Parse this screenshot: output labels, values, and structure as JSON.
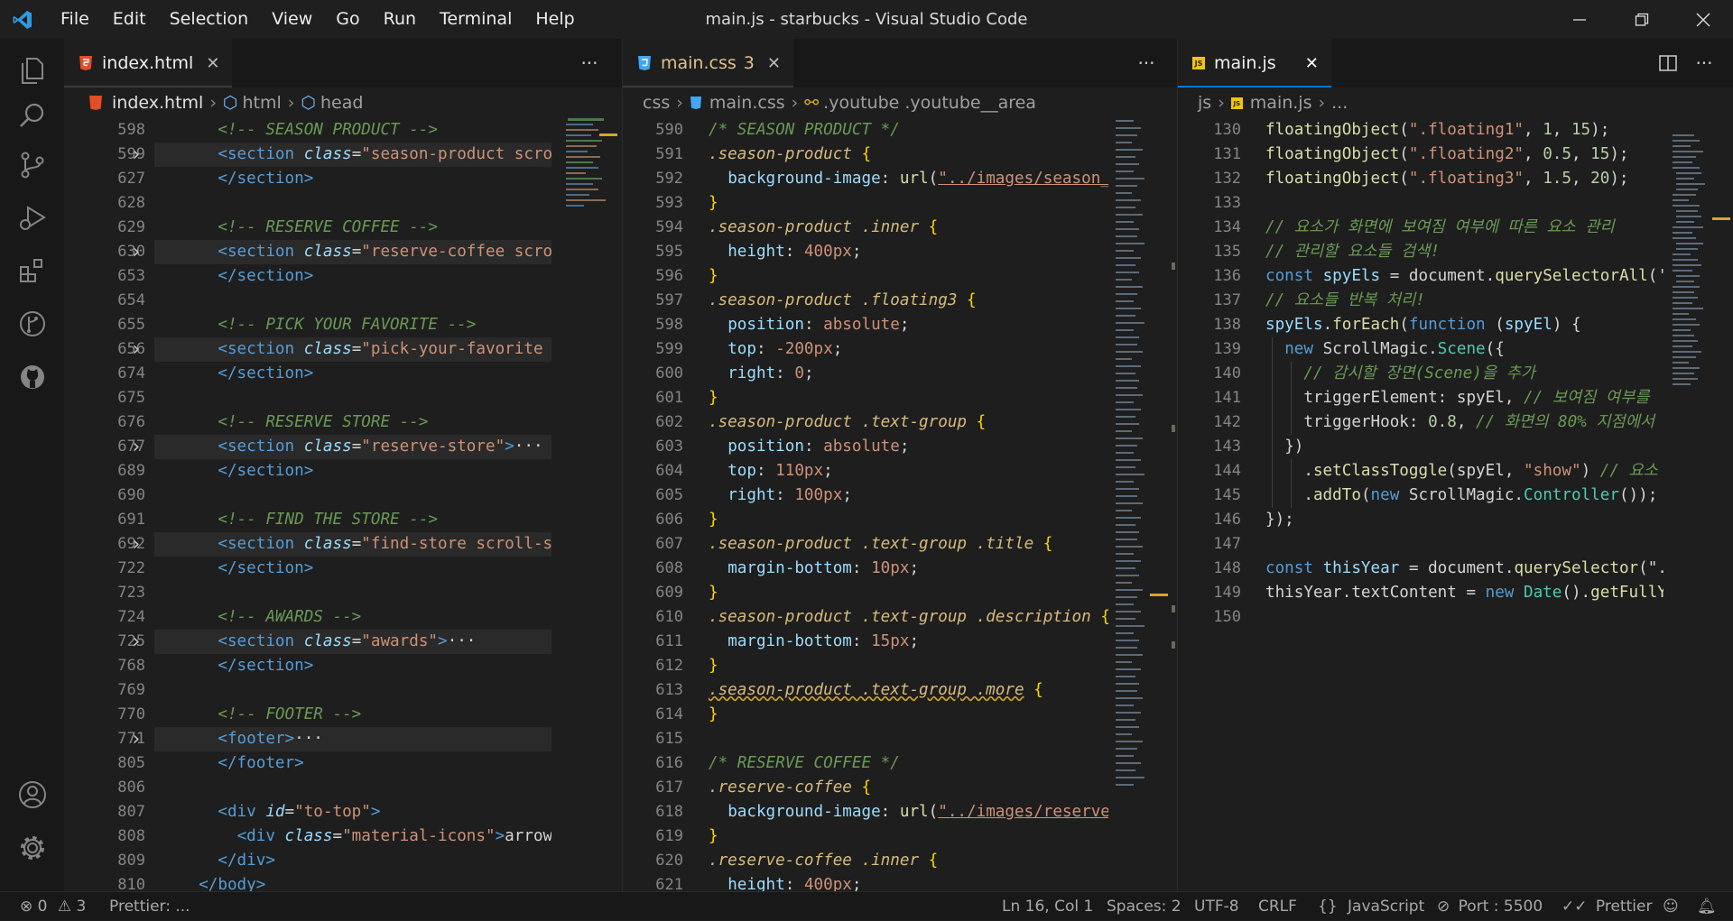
{
  "menu": [
    "File",
    "Edit",
    "Selection",
    "View",
    "Go",
    "Run",
    "Terminal",
    "Help"
  ],
  "window_title": "main.js - starbucks - Visual Studio Code",
  "panes": [
    {
      "tab": {
        "label": "index.html",
        "badge": ""
      },
      "crumbs": [
        "index.html",
        "html",
        "head"
      ],
      "lines": [
        {
          "n": "598",
          "fold": false,
          "html": "    <span class='c-com'>&lt;!-- SEASON PRODUCT --&gt;</span>"
        },
        {
          "n": "599",
          "fold": true,
          "hl": true,
          "html": "    <span class='c-tag'>&lt;section</span> <span class='c-attr'>class</span><span class='c-txt'>=</span><span class='c-str'>\"season-product scroll-</span>"
        },
        {
          "n": "627",
          "fold": false,
          "html": "    <span class='c-tag'>&lt;/section&gt;</span>"
        },
        {
          "n": "628",
          "fold": false,
          "html": ""
        },
        {
          "n": "629",
          "fold": false,
          "html": "    <span class='c-com'>&lt;!-- RESERVE COFFEE --&gt;</span>"
        },
        {
          "n": "630",
          "fold": true,
          "hl": true,
          "html": "    <span class='c-tag'>&lt;section</span> <span class='c-attr'>class</span><span class='c-txt'>=</span><span class='c-str'>\"reserve-coffee scroll-</span>"
        },
        {
          "n": "653",
          "fold": false,
          "html": "    <span class='c-tag'>&lt;/section&gt;</span>"
        },
        {
          "n": "654",
          "fold": false,
          "html": ""
        },
        {
          "n": "655",
          "fold": false,
          "html": "    <span class='c-com'>&lt;!-- PICK YOUR FAVORITE --&gt;</span>"
        },
        {
          "n": "656",
          "fold": true,
          "hl": true,
          "html": "    <span class='c-tag'>&lt;section</span> <span class='c-attr'>class</span><span class='c-txt'>=</span><span class='c-str'>\"pick-your-favorite scr</span>"
        },
        {
          "n": "674",
          "fold": false,
          "html": "    <span class='c-tag'>&lt;/section&gt;</span>"
        },
        {
          "n": "675",
          "fold": false,
          "html": ""
        },
        {
          "n": "676",
          "fold": false,
          "html": "    <span class='c-com'>&lt;!-- RESERVE STORE --&gt;</span>"
        },
        {
          "n": "677",
          "fold": true,
          "hl": true,
          "html": "    <span class='c-tag'>&lt;section</span> <span class='c-attr'>class</span><span class='c-txt'>=</span><span class='c-str'>\"reserve-store\"</span><span class='c-tag'>&gt;</span><span class='c-txt'>···</span>"
        },
        {
          "n": "689",
          "fold": false,
          "html": "    <span class='c-tag'>&lt;/section&gt;</span>"
        },
        {
          "n": "690",
          "fold": false,
          "html": ""
        },
        {
          "n": "691",
          "fold": false,
          "html": "    <span class='c-com'>&lt;!-- FIND THE STORE --&gt;</span>"
        },
        {
          "n": "692",
          "fold": true,
          "hl": true,
          "html": "    <span class='c-tag'>&lt;section</span> <span class='c-attr'>class</span><span class='c-txt'>=</span><span class='c-str'>\"find-store scroll-spy'</span>"
        },
        {
          "n": "722",
          "fold": false,
          "html": "    <span class='c-tag'>&lt;/section&gt;</span>"
        },
        {
          "n": "723",
          "fold": false,
          "html": ""
        },
        {
          "n": "724",
          "fold": false,
          "html": "    <span class='c-com'>&lt;!-- AWARDS --&gt;</span>"
        },
        {
          "n": "725",
          "fold": true,
          "hl": true,
          "html": "    <span class='c-tag'>&lt;section</span> <span class='c-attr'>class</span><span class='c-txt'>=</span><span class='c-str'>\"awards\"</span><span class='c-tag'>&gt;</span><span class='c-txt'>···</span>"
        },
        {
          "n": "768",
          "fold": false,
          "html": "    <span class='c-tag'>&lt;/section&gt;</span>"
        },
        {
          "n": "769",
          "fold": false,
          "html": ""
        },
        {
          "n": "770",
          "fold": false,
          "html": "    <span class='c-com'>&lt;!-- FOOTER --&gt;</span>"
        },
        {
          "n": "771",
          "fold": true,
          "hl": true,
          "html": "    <span class='c-tag'>&lt;footer&gt;</span><span class='c-txt'>···</span>"
        },
        {
          "n": "805",
          "fold": false,
          "html": "    <span class='c-tag'>&lt;/footer&gt;</span>"
        },
        {
          "n": "806",
          "fold": false,
          "html": ""
        },
        {
          "n": "807",
          "fold": false,
          "html": "    <span class='c-tag'>&lt;div</span> <span class='c-attr'>id</span><span class='c-txt'>=</span><span class='c-str'>\"to-top\"</span><span class='c-tag'>&gt;</span>"
        },
        {
          "n": "808",
          "fold": false,
          "html": "      <span class='c-tag'>&lt;div</span> <span class='c-attr'>class</span><span class='c-txt'>=</span><span class='c-str'>\"material-icons\"</span><span class='c-tag'>&gt;</span><span class='c-txt'>arrow_up</span>"
        },
        {
          "n": "809",
          "fold": false,
          "html": "    <span class='c-tag'>&lt;/div&gt;</span>"
        },
        {
          "n": "810",
          "fold": false,
          "html": "  <span class='c-tag'>&lt;/body&gt;</span>"
        }
      ]
    },
    {
      "tab": {
        "label": "main.css",
        "badge": "3"
      },
      "crumbs": [
        "css",
        "main.css",
        ".youtube .youtube__area"
      ],
      "lines": [
        {
          "n": "590",
          "html": "<span class='c-com'>/* SEASON PRODUCT */</span>"
        },
        {
          "n": "591",
          "html": "<span class='c-sel'>.season-product</span> <span class='c-punc'>{</span>"
        },
        {
          "n": "592",
          "html": "  <span class='c-prop'>background-image</span><span class='c-txt'>: </span><span class='c-fn'>url</span><span class='c-txt'>(</span><span class='c-str' style='text-decoration:underline'>\"../images/season_</span>"
        },
        {
          "n": "593",
          "html": "<span class='c-punc'>}</span>"
        },
        {
          "n": "594",
          "html": "<span class='c-sel'>.season-product</span> <span class='c-sel'>.inner</span> <span class='c-punc'>{</span>"
        },
        {
          "n": "595",
          "html": "  <span class='c-prop'>height</span><span class='c-txt'>: </span><span class='c-str'>400px</span><span class='c-txt'>;</span>"
        },
        {
          "n": "596",
          "html": "<span class='c-punc'>}</span>"
        },
        {
          "n": "597",
          "html": "<span class='c-sel'>.season-product</span> <span class='c-sel'>.floating3</span> <span class='c-punc'>{</span>"
        },
        {
          "n": "598",
          "html": "  <span class='c-prop'>position</span><span class='c-txt'>: </span><span class='c-str'>absolute</span><span class='c-txt'>;</span>"
        },
        {
          "n": "599",
          "html": "  <span class='c-prop'>top</span><span class='c-txt'>: </span><span class='c-str'>-200px</span><span class='c-txt'>;</span>"
        },
        {
          "n": "600",
          "html": "  <span class='c-prop'>right</span><span class='c-txt'>: </span><span class='c-str'>0</span><span class='c-txt'>;</span>"
        },
        {
          "n": "601",
          "html": "<span class='c-punc'>}</span>"
        },
        {
          "n": "602",
          "html": "<span class='c-sel'>.season-product</span> <span class='c-sel'>.text-group</span> <span class='c-punc'>{</span>"
        },
        {
          "n": "603",
          "html": "  <span class='c-prop'>position</span><span class='c-txt'>: </span><span class='c-str'>absolute</span><span class='c-txt'>;</span>"
        },
        {
          "n": "604",
          "html": "  <span class='c-prop'>top</span><span class='c-txt'>: </span><span class='c-str'>110px</span><span class='c-txt'>;</span>"
        },
        {
          "n": "605",
          "html": "  <span class='c-prop'>right</span><span class='c-txt'>: </span><span class='c-str'>100px</span><span class='c-txt'>;</span>"
        },
        {
          "n": "606",
          "html": "<span class='c-punc'>}</span>"
        },
        {
          "n": "607",
          "html": "<span class='c-sel'>.season-product</span> <span class='c-sel'>.text-group</span> <span class='c-sel'>.title</span> <span class='c-punc'>{</span>"
        },
        {
          "n": "608",
          "html": "  <span class='c-prop'>margin-bottom</span><span class='c-txt'>: </span><span class='c-str'>10px</span><span class='c-txt'>;</span>"
        },
        {
          "n": "609",
          "html": "<span class='c-punc'>}</span>"
        },
        {
          "n": "610",
          "html": "<span class='c-sel'>.season-product</span> <span class='c-sel'>.text-group</span> <span class='c-sel'>.description</span> <span class='c-punc'>{</span>"
        },
        {
          "n": "611",
          "html": "  <span class='c-prop'>margin-bottom</span><span class='c-txt'>: </span><span class='c-str'>15px</span><span class='c-txt'>;</span>"
        },
        {
          "n": "612",
          "html": "<span class='c-punc'>}</span>"
        },
        {
          "n": "613",
          "html": "<span class='c-sel' style='text-decoration:underline wavy #c9a227'>.season-product .text-group .more</span> <span class='c-punc'>{</span>"
        },
        {
          "n": "614",
          "html": "<span class='c-punc'>}</span>"
        },
        {
          "n": "615",
          "html": ""
        },
        {
          "n": "616",
          "html": "<span class='c-com'>/* RESERVE COFFEE */</span>"
        },
        {
          "n": "617",
          "html": "<span class='c-sel'>.reserve-coffee</span> <span class='c-punc'>{</span>"
        },
        {
          "n": "618",
          "html": "  <span class='c-prop'>background-image</span><span class='c-txt'>: </span><span class='c-fn'>url</span><span class='c-txt'>(</span><span class='c-str' style='text-decoration:underline'>\"../images/reserve</span>"
        },
        {
          "n": "619",
          "html": "<span class='c-punc'>}</span>"
        },
        {
          "n": "620",
          "html": "<span class='c-sel'>.reserve-coffee</span> <span class='c-sel'>.inner</span> <span class='c-punc'>{</span>"
        },
        {
          "n": "621",
          "html": "  <span class='c-prop'>height</span><span class='c-txt'>: </span><span class='c-str'>400px</span><span class='c-txt'>;</span>"
        }
      ]
    },
    {
      "tab": {
        "label": "main.js",
        "badge": ""
      },
      "crumbs": [
        "js",
        "main.js",
        "..."
      ],
      "lines": [
        {
          "n": "130",
          "html": "<span class='c-fn'>floatingObject</span><span class='c-txt'>(</span><span class='c-str'>\".floating1\"</span><span class='c-txt'>, </span><span class='c-num'>1</span><span class='c-txt'>, </span><span class='c-num'>15</span><span class='c-txt'>);</span>"
        },
        {
          "n": "131",
          "html": "<span class='c-fn'>floatingObject</span><span class='c-txt'>(</span><span class='c-str'>\".floating2\"</span><span class='c-txt'>, </span><span class='c-num'>0.5</span><span class='c-txt'>, </span><span class='c-num'>15</span><span class='c-txt'>);</span>"
        },
        {
          "n": "132",
          "html": "<span class='c-fn'>floatingObject</span><span class='c-txt'>(</span><span class='c-str'>\".floating3\"</span><span class='c-txt'>, </span><span class='c-num'>1.5</span><span class='c-txt'>, </span><span class='c-num'>20</span><span class='c-txt'>);</span>"
        },
        {
          "n": "133",
          "html": ""
        },
        {
          "n": "134",
          "html": "<span class='c-com2'>// 요소가 화면에 보여짐 여부에 따른 요소 관리</span>"
        },
        {
          "n": "135",
          "html": "<span class='c-com2'>// 관리할 요소들 검색!</span>"
        },
        {
          "n": "136",
          "html": "<span class='c-kw'>const</span> <span class='c-var'>spyEls</span> <span class='c-txt'>= document.</span><span class='c-fn'>querySelectorAll</span><span class='c-txt'>('.</span>"
        },
        {
          "n": "137",
          "html": "<span class='c-com2'>// 요소들 반복 처리!</span>"
        },
        {
          "n": "138",
          "html": "<span class='c-var'>spyEls</span><span class='c-txt'>.</span><span class='c-fn'>forEach</span><span class='c-txt'>(</span><span class='c-kw'>function</span> <span class='c-txt'>(</span><span class='c-var'>spyEl</span><span class='c-txt'>) {</span>"
        },
        {
          "n": "139",
          "html": "  <span class='c-kw'>new</span> <span class='c-txt'>ScrollMagic.</span><span class='c-cls'>Scene</span><span class='c-txt'>({</span>"
        },
        {
          "n": "140",
          "html": "    <span class='c-com2'>// 감시할 장면(Scene)을 추가</span>"
        },
        {
          "n": "141",
          "html": "    <span class='c-txt'>triggerElement: spyEl, </span><span class='c-com2'>// 보여짐 여부를</span>"
        },
        {
          "n": "142",
          "html": "    <span class='c-txt'>triggerHook: </span><span class='c-num'>0.8</span><span class='c-txt'>, </span><span class='c-com2'>// 화면의 80% 지점에서</span>"
        },
        {
          "n": "143",
          "html": "  <span class='c-txt'>})</span>"
        },
        {
          "n": "144",
          "html": "    <span class='c-txt'>.</span><span class='c-fn'>setClassToggle</span><span class='c-txt'>(spyEl, </span><span class='c-str'>\"show\"</span><span class='c-txt'>) </span><span class='c-com2'>// 요소</span>"
        },
        {
          "n": "145",
          "html": "    <span class='c-txt'>.</span><span class='c-fn'>addTo</span><span class='c-txt'>(</span><span class='c-kw'>new</span> <span class='c-txt'>ScrollMagic.</span><span class='c-cls'>Controller</span><span class='c-txt'>());</span>"
        },
        {
          "n": "146",
          "html": "<span class='c-txt'>});</span>"
        },
        {
          "n": "147",
          "html": ""
        },
        {
          "n": "148",
          "html": "<span class='c-kw'>const</span> <span class='c-var'>thisYear</span> <span class='c-txt'>= document.</span><span class='c-fn'>querySelector</span><span class='c-txt'>(\".</span>"
        },
        {
          "n": "149",
          "html": "<span class='c-txt'>thisYear.textContent = </span><span class='c-kw'>new</span> <span class='c-cls'>Date</span><span class='c-txt'>().</span><span class='c-fn'>getFullY</span>"
        },
        {
          "n": "150",
          "html": ""
        }
      ]
    }
  ],
  "statusbar": {
    "errors": "0",
    "warnings": "3",
    "prettier_left": "Prettier: ...",
    "position": "Ln 16, Col 1",
    "spaces": "Spaces: 2",
    "encoding": "UTF-8",
    "eol": "CRLF",
    "language": "JavaScript",
    "port": "Port : 5500",
    "prettier": "Prettier"
  }
}
